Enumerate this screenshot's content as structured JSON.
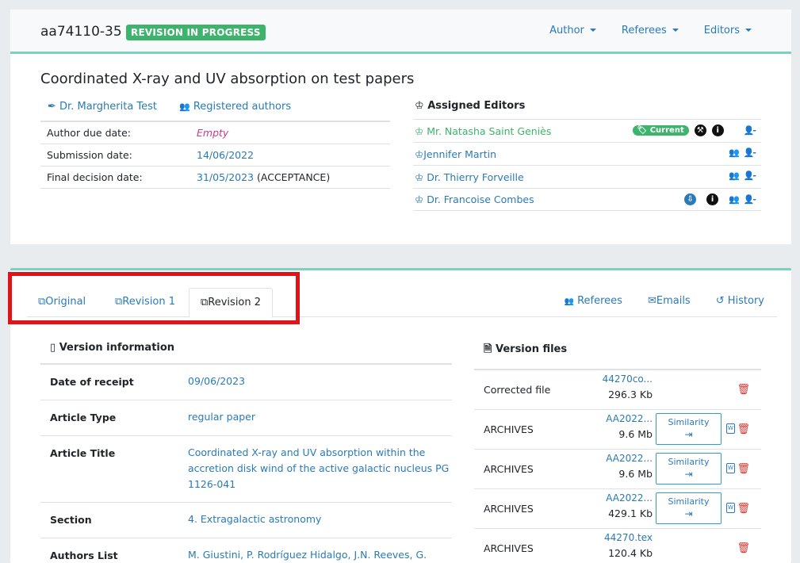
{
  "manuscript": {
    "id": "aa74110-35",
    "status": "REVISION IN PROGRESS",
    "title": "Coordinated X-ray and UV absorption on test papers"
  },
  "topnav": [
    {
      "label": "Author"
    },
    {
      "label": "Referees"
    },
    {
      "label": "Editors"
    }
  ],
  "author": {
    "name": "Dr. Margherita Test",
    "registered": "Registered authors"
  },
  "dates": [
    {
      "label": "Author due date:",
      "value": "Empty",
      "extra": ""
    },
    {
      "label": "Submission date:",
      "value": "14/06/2022",
      "extra": ""
    },
    {
      "label": "Final decision date:",
      "value": "31/05/2023",
      "extra": " (ACCEPTANCE)"
    }
  ],
  "editors": {
    "heading": "Assigned Editors",
    "current_label": "Current",
    "list": [
      {
        "name": "Mr. Natasha Saint Geniès"
      },
      {
        "name": "Jennifer Martin"
      },
      {
        "name": "Dr. Thierry Forveille"
      },
      {
        "name": "Dr. Francoise Combes"
      }
    ]
  },
  "tabs": [
    {
      "label": "Original"
    },
    {
      "label": "Revision 1"
    },
    {
      "label": "Revision 2"
    }
  ],
  "right_tabs": [
    {
      "label": "Referees"
    },
    {
      "label": "Emails"
    },
    {
      "label": "History"
    }
  ],
  "version_info": {
    "heading": "Version information",
    "rows": [
      {
        "key": "Date of receipt",
        "value": "09/06/2023"
      },
      {
        "key": "Article Type",
        "value": "regular paper"
      },
      {
        "key": "Article Title",
        "value": "Coordinated X-ray and UV absorption within the accretion disk wind of the active galactic nucleus PG 1126-041"
      },
      {
        "key": "Section",
        "value": "4. Extragalactic astronomy"
      },
      {
        "key": "Authors List",
        "value": "M. Giustini, P. Rodríguez Hidalgo, J.N. Reeves, G."
      }
    ]
  },
  "version_files": {
    "heading": "Version files",
    "similarity_label": "Similarity",
    "rows": [
      {
        "type": "Corrected file",
        "name": "44270co...",
        "size": "296.3 Kb"
      },
      {
        "type": "ARCHIVES",
        "name": "AA2022...",
        "size": "9.6 Mb"
      },
      {
        "type": "ARCHIVES",
        "name": "AA2022...",
        "size": "9.6 Mb"
      },
      {
        "type": "ARCHIVES",
        "name": "AA2022...",
        "size": "429.1 Kb"
      },
      {
        "type": "ARCHIVES",
        "name": "44270.tex",
        "size": "120.4 Kb"
      }
    ]
  },
  "colors": {
    "accent": "#2a7ab7",
    "success": "#3db36b",
    "danger": "#d9352f",
    "highlight": "#e0131a",
    "divider": "#7fd1bd"
  }
}
